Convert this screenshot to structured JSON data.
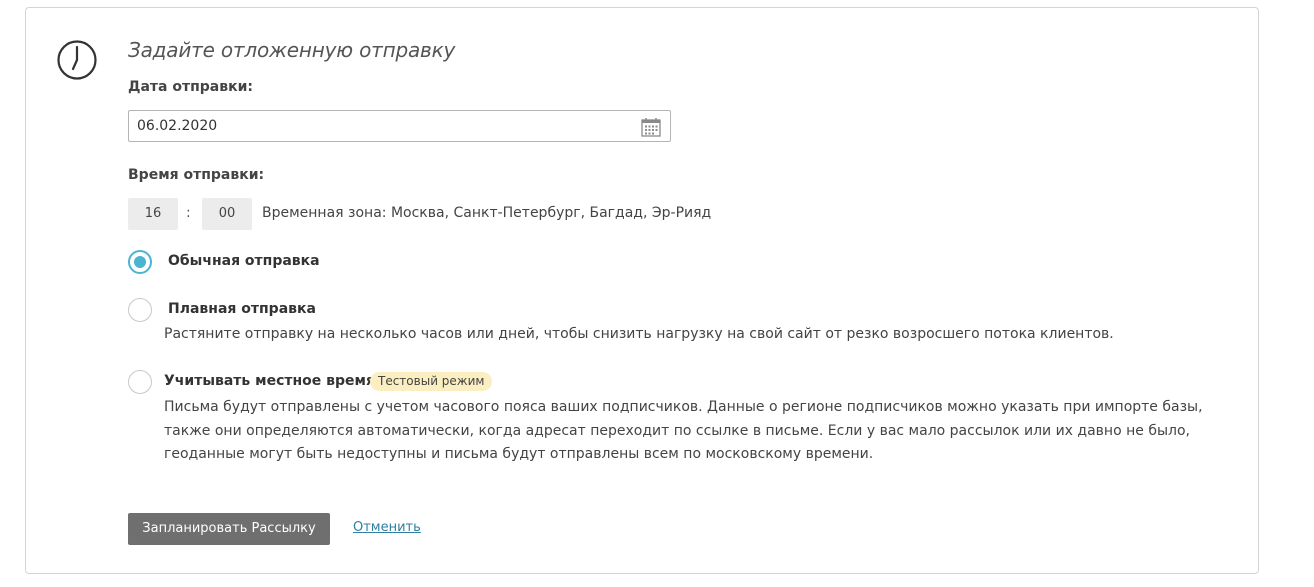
{
  "header": {
    "title": "Задайте отложенную отправку",
    "icon": "clock-icon"
  },
  "date": {
    "label": "Дата отправки:",
    "value": "06.02.2020",
    "icon": "calendar-icon"
  },
  "time": {
    "label": "Время отправки:",
    "hours": "16",
    "separator": ":",
    "minutes": "00",
    "timezone": "Временная зона: Москва, Санкт-Петербург, Багдад, Эр-Рияд"
  },
  "options": [
    {
      "label": "Обычная отправка",
      "selected": true
    },
    {
      "label": "Плавная отправка",
      "selected": false,
      "description": "Растяните отправку на несколько часов или дней, чтобы снизить нагрузку на свой сайт от резко возросшего потока клиентов."
    },
    {
      "label": "Учитывать местное время",
      "selected": false,
      "badge": "Тестовый режим",
      "description_lines": [
        "Письма будут отправлены с учетом часового пояса ваших подписчиков. Данные о регионе подписчиков можно указать при импорте базы,",
        "также они определяются автоматически, когда адресат переходит по ссылке в письме. Если у вас мало рассылок или их давно не было,",
        "геоданные могут быть недоступны и письма будут отправлены всем по московскому времени."
      ]
    }
  ],
  "actions": {
    "submit": "Запланировать Рассылку",
    "cancel": "Отменить"
  },
  "colors": {
    "accent": "#4bb5d1",
    "button": "#6f6f6f",
    "link": "#2f7fa0",
    "badge": "#fbeec0"
  }
}
